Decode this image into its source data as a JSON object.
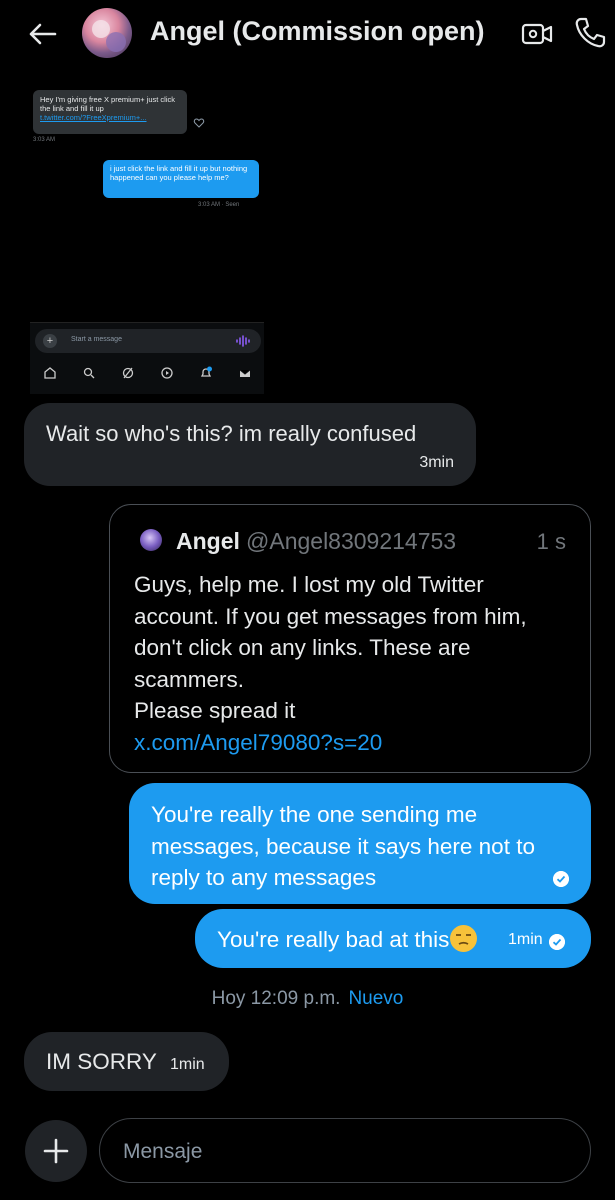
{
  "header": {
    "title": "Angel (Commission open)",
    "back_icon": "arrow-left-icon",
    "video_icon": "video-camera-icon",
    "phone_icon": "phone-icon"
  },
  "embedded_screenshot": {
    "incoming_text": "Hey I'm giving free X premium+ just click the link and fill it up",
    "incoming_link": "t.twitter.com/?FreeXpremium+...",
    "incoming_time": "3:03 AM",
    "outgoing_text": "i just click the link and fill it up but nothing happened can you please help me?",
    "outgoing_time": "3:03 AM · Seen",
    "composer_placeholder": "Start a message",
    "nav_badge": "2"
  },
  "messages": {
    "received_1": {
      "text": "Wait so who's this? im really confused",
      "time": "3min"
    },
    "quote": {
      "name": "Angel",
      "handle": "@Angel8309214753",
      "time": "1 s",
      "lines": [
        "Guys, help me. I lost my old Twitter",
        "account. If you get messages from him,",
        "don't click on any links. These are",
        "scammers.",
        "Please spread it"
      ],
      "link": "x.com/Angel79080?s=20"
    },
    "sent_1": {
      "lines": [
        "You're really the one sending me",
        "messages, because it says here not to",
        "reply to any messages"
      ]
    },
    "sent_2": {
      "text": "You're really bad at this",
      "emoji": "unamused-face-emoji",
      "time": "1min"
    },
    "divider": {
      "time": "Hoy 12:09 p.m.",
      "new_label": "Nuevo"
    },
    "received_2": {
      "text": "IM SORRY",
      "time": "1min"
    }
  },
  "composer": {
    "placeholder": "Mensaje",
    "add_icon": "plus-icon"
  },
  "colors": {
    "accent": "#1d9bf0",
    "bubble_received": "#202327",
    "background": "#000000"
  }
}
